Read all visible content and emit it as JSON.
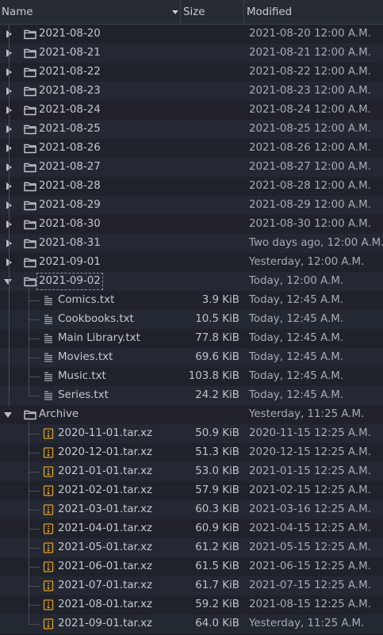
{
  "columns": {
    "name": "Name",
    "size": "Size",
    "modified": "Modified"
  },
  "rows": [
    {
      "type": "folder",
      "expanded": false,
      "name": "2021-08-20",
      "size": "",
      "modified": "2021-08-20 12:00 A.M."
    },
    {
      "type": "folder",
      "expanded": false,
      "name": "2021-08-21",
      "size": "",
      "modified": "2021-08-21 12:00 A.M."
    },
    {
      "type": "folder",
      "expanded": false,
      "name": "2021-08-22",
      "size": "",
      "modified": "2021-08-22 12:00 A.M."
    },
    {
      "type": "folder",
      "expanded": false,
      "name": "2021-08-23",
      "size": "",
      "modified": "2021-08-23 12:00 A.M."
    },
    {
      "type": "folder",
      "expanded": false,
      "name": "2021-08-24",
      "size": "",
      "modified": "2021-08-24 12:00 A.M."
    },
    {
      "type": "folder",
      "expanded": false,
      "name": "2021-08-25",
      "size": "",
      "modified": "2021-08-25 12:00 A.M."
    },
    {
      "type": "folder",
      "expanded": false,
      "name": "2021-08-26",
      "size": "",
      "modified": "2021-08-26 12:00 A.M."
    },
    {
      "type": "folder",
      "expanded": false,
      "name": "2021-08-27",
      "size": "",
      "modified": "2021-08-27 12:00 A.M."
    },
    {
      "type": "folder",
      "expanded": false,
      "name": "2021-08-28",
      "size": "",
      "modified": "2021-08-28 12:00 A.M."
    },
    {
      "type": "folder",
      "expanded": false,
      "name": "2021-08-29",
      "size": "",
      "modified": "2021-08-29 12:00 A.M."
    },
    {
      "type": "folder",
      "expanded": false,
      "name": "2021-08-30",
      "size": "",
      "modified": "2021-08-30 12:00 A.M."
    },
    {
      "type": "folder",
      "expanded": false,
      "name": "2021-08-31",
      "size": "",
      "modified": "Two days ago, 12:00 A.M."
    },
    {
      "type": "folder",
      "expanded": false,
      "name": "2021-09-01",
      "size": "",
      "modified": "Yesterday, 12:00 A.M."
    },
    {
      "type": "folder",
      "expanded": true,
      "focused": true,
      "name": "2021-09-02",
      "size": "",
      "modified": "Today, 12:00 A.M."
    },
    {
      "type": "text",
      "name": "Comics.txt",
      "size": "3.9 KiB",
      "modified": "Today, 12:45 A.M."
    },
    {
      "type": "text",
      "name": "Cookbooks.txt",
      "size": "10.5 KiB",
      "modified": "Today, 12:45 A.M."
    },
    {
      "type": "text",
      "name": "Main Library.txt",
      "size": "77.8 KiB",
      "modified": "Today, 12:45 A.M."
    },
    {
      "type": "text",
      "name": "Movies.txt",
      "size": "69.6 KiB",
      "modified": "Today, 12:45 A.M."
    },
    {
      "type": "text",
      "name": "Music.txt",
      "size": "103.8 KiB",
      "modified": "Today, 12:45 A.M."
    },
    {
      "type": "text",
      "name": "Series.txt",
      "size": "24.2 KiB",
      "modified": "Today, 12:45 A.M."
    },
    {
      "type": "folder",
      "expanded": true,
      "name": "Archive",
      "size": "",
      "modified": "Yesterday, 11:25 A.M."
    },
    {
      "type": "archive",
      "name": "2020-11-01.tar.xz",
      "size": "50.9 KiB",
      "modified": "2020-11-15 12:25 A.M."
    },
    {
      "type": "archive",
      "name": "2020-12-01.tar.xz",
      "size": "51.3 KiB",
      "modified": "2020-12-15 12:25 A.M."
    },
    {
      "type": "archive",
      "name": "2021-01-01.tar.xz",
      "size": "53.0 KiB",
      "modified": "2021-01-15 12:25 A.M."
    },
    {
      "type": "archive",
      "name": "2021-02-01.tar.xz",
      "size": "57.9 KiB",
      "modified": "2021-02-15 12:25 A.M."
    },
    {
      "type": "archive",
      "name": "2021-03-01.tar.xz",
      "size": "60.3 KiB",
      "modified": "2021-03-16 12:25 A.M."
    },
    {
      "type": "archive",
      "name": "2021-04-01.tar.xz",
      "size": "60.9 KiB",
      "modified": "2021-04-15 12:25 A.M."
    },
    {
      "type": "archive",
      "name": "2021-05-01.tar.xz",
      "size": "61.2 KiB",
      "modified": "2021-05-15 12:25 A.M."
    },
    {
      "type": "archive",
      "name": "2021-06-01.tar.xz",
      "size": "61.5 KiB",
      "modified": "2021-06-15 12:25 A.M."
    },
    {
      "type": "archive",
      "name": "2021-07-01.tar.xz",
      "size": "61.7 KiB",
      "modified": "2021-07-15 12:25 A.M."
    },
    {
      "type": "archive",
      "name": "2021-08-01.tar.xz",
      "size": "59.2 KiB",
      "modified": "2021-08-15 12:25 A.M."
    },
    {
      "type": "archive",
      "name": "2021-09-01.tar.xz",
      "size": "64.0 KiB",
      "modified": "Yesterday, 11:25 A.M."
    }
  ],
  "icons": {
    "folder": "folder-icon",
    "text": "text-file-icon",
    "archive": "archive-file-icon",
    "collapsed": "expand-arrow-icon",
    "expanded": "collapse-arrow-icon",
    "sort": "sort-descending-icon"
  },
  "colors": {
    "background": "#1b1e26",
    "row_alt": "#242833",
    "header": "#272b34",
    "text": "#c4c7cd",
    "muted": "#a7abb3",
    "archive_icon": "#e0a020"
  }
}
